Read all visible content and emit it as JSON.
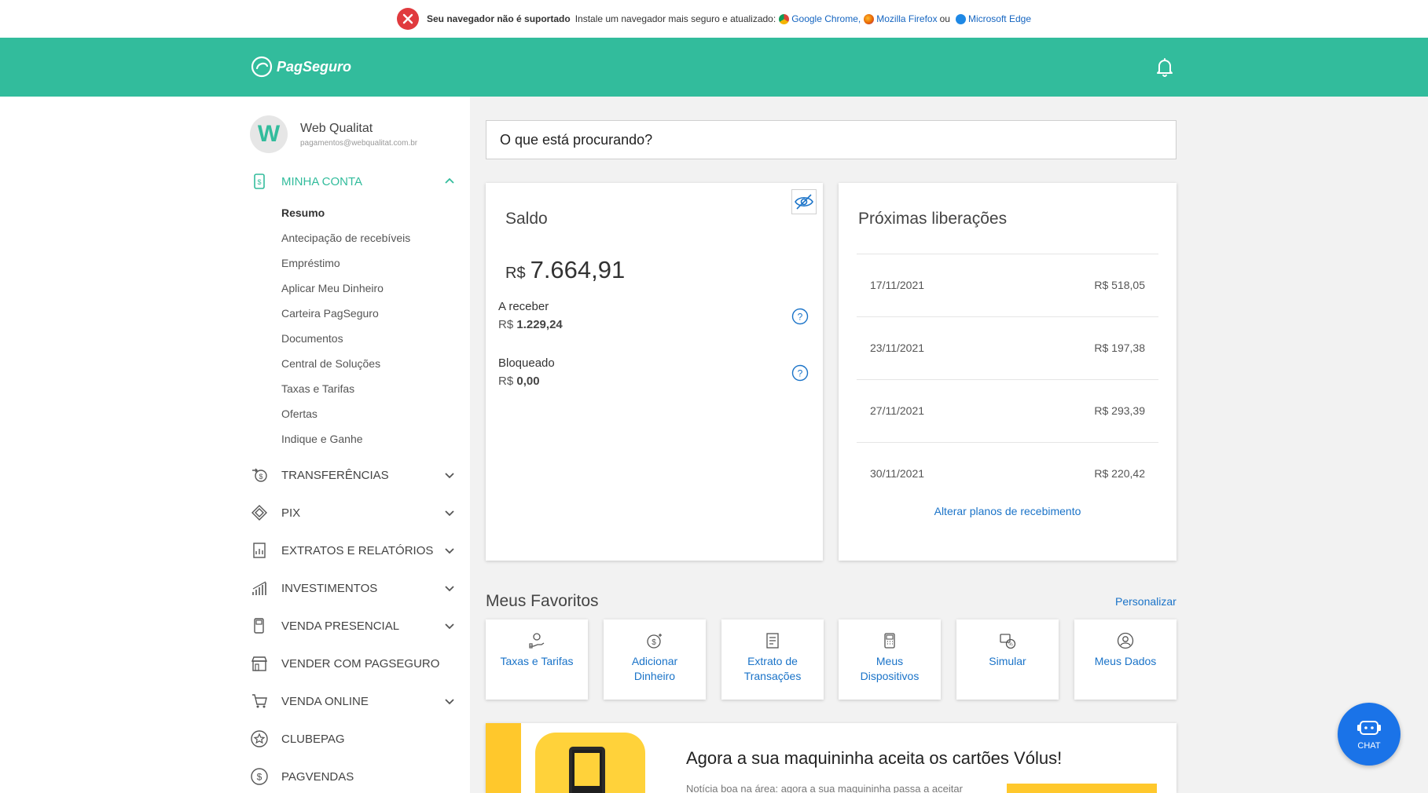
{
  "browser_warning": {
    "title": "Seu navegador não é suportado",
    "message": "Instale um navegador mais seguro e atualizado:",
    "chrome": "Google Chrome,",
    "firefox": "Mozilla Firefox",
    "or": "ou",
    "edge": "Microsoft Edge"
  },
  "header": {
    "logo": "PagSeguro"
  },
  "profile": {
    "initial": "W",
    "name": "Web Qualitat",
    "email": "pagamentos@webqualitat.com.br"
  },
  "sidebar": {
    "minha_conta": "MINHA CONTA",
    "sub_items": [
      "Resumo",
      "Antecipação de recebíveis",
      "Empréstimo",
      "Aplicar Meu Dinheiro",
      "Carteira PagSeguro",
      "Documentos",
      "Central de Soluções",
      "Taxas e Tarifas",
      "Ofertas",
      "Indique e Ganhe"
    ],
    "items": [
      "TRANSFERÊNCIAS",
      "PIX",
      "EXTRATOS E RELATÓRIOS",
      "INVESTIMENTOS",
      "VENDA PRESENCIAL",
      "VENDER COM PAGSEGURO",
      "VENDA ONLINE",
      "CLUBEPAG",
      "PAGVENDAS"
    ]
  },
  "search": {
    "placeholder": "O que está procurando?"
  },
  "saldo": {
    "title": "Saldo",
    "currency": "R$",
    "value": "7.664,91",
    "a_receber_label": "A receber",
    "a_receber_currency": "R$",
    "a_receber_value": "1.229,24",
    "bloqueado_label": "Bloqueado",
    "bloqueado_currency": "R$",
    "bloqueado_value": "0,00"
  },
  "liberacoes": {
    "title": "Próximas liberações",
    "rows": [
      {
        "date": "17/11/2021",
        "amount": "R$ 518,05"
      },
      {
        "date": "23/11/2021",
        "amount": "R$ 197,38"
      },
      {
        "date": "27/11/2021",
        "amount": "R$ 293,39"
      },
      {
        "date": "30/11/2021",
        "amount": "R$ 220,42"
      }
    ],
    "link": "Alterar planos de recebimento"
  },
  "favoritos": {
    "title": "Meus Favoritos",
    "personalize": "Personalizar",
    "items": [
      {
        "label": "Taxas e Tarifas",
        "icon": "hand-money-icon"
      },
      {
        "label": "Adicionar Dinheiro",
        "icon": "add-money-icon"
      },
      {
        "label": "Extrato de Transações",
        "icon": "statement-icon"
      },
      {
        "label": "Meus Dispositivos",
        "icon": "card-machine-icon"
      },
      {
        "label": "Simular",
        "icon": "simulate-icon"
      },
      {
        "label": "Meus Dados",
        "icon": "user-icon"
      }
    ]
  },
  "promo": {
    "title": "Agora a sua maquininha aceita os cartões Vólus!",
    "text": "Notícia boa na área: agora a sua maquininha passa a aceitar"
  },
  "chat": {
    "label": "CHAT"
  },
  "colors": {
    "brand": "#32bc9c",
    "link": "#1a73c8",
    "warning": "#e03a3e",
    "chat": "#1a73e8",
    "promo": "#ffc82c"
  }
}
